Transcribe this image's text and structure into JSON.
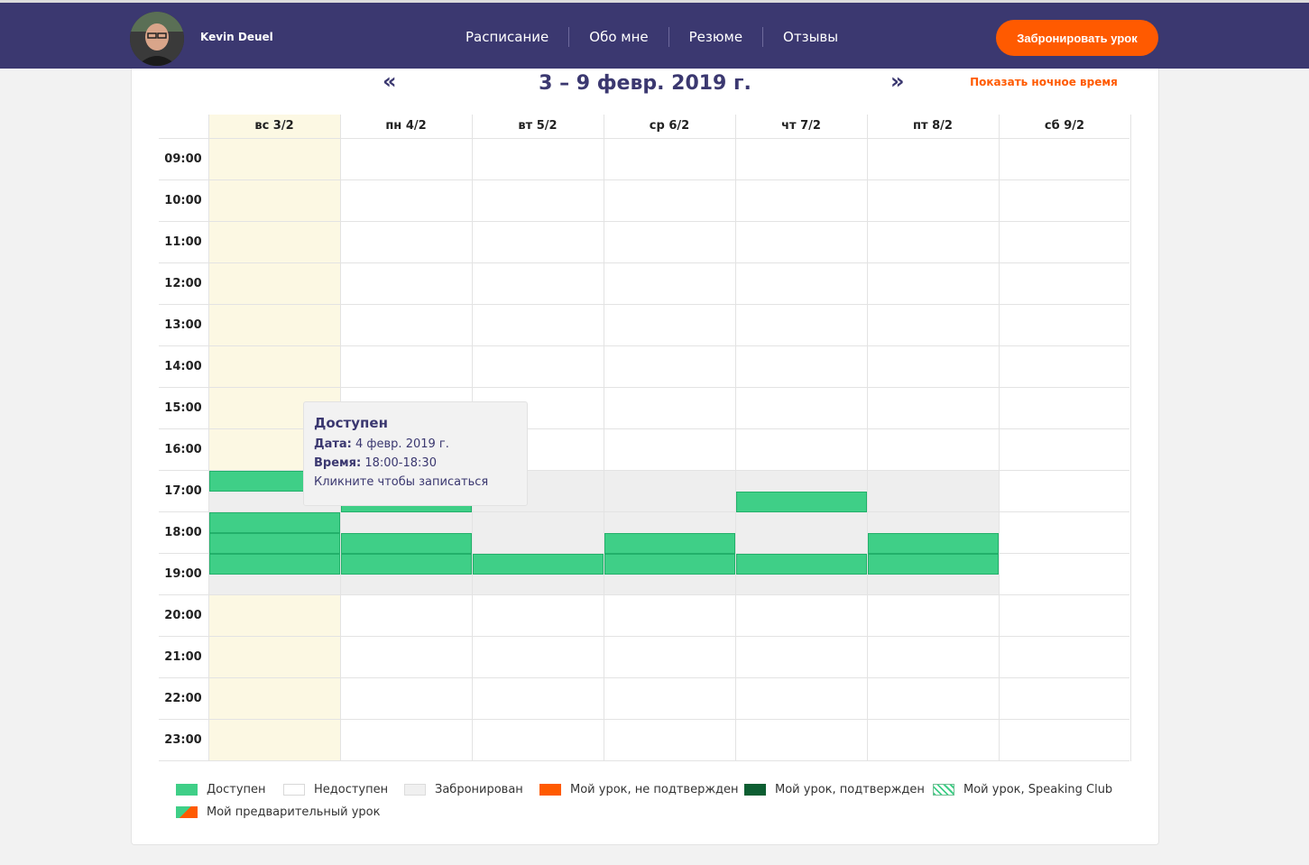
{
  "header": {
    "username": "Kevin Deuel",
    "nav": [
      "Расписание",
      "Обо мне",
      "Резюме",
      "Отзывы"
    ],
    "book_label": "Забронировать урок"
  },
  "calendar": {
    "prev": "«",
    "next": "»",
    "week_title": "3 – 9 февр. 2019 г.",
    "night_link": "Показать ночное время",
    "days": [
      "вс 3/2",
      "пн 4/2",
      "вт 5/2",
      "ср 6/2",
      "чт 7/2",
      "пт 8/2",
      "сб 9/2"
    ],
    "hours": [
      "09:00",
      "10:00",
      "11:00",
      "12:00",
      "13:00",
      "14:00",
      "15:00",
      "16:00",
      "17:00",
      "18:00",
      "19:00",
      "20:00",
      "21:00",
      "22:00",
      "23:00"
    ],
    "today_index": 0,
    "booked": [
      {
        "day": 0,
        "start": "17:00",
        "end": "20:00"
      },
      {
        "day": 1,
        "start": "17:00",
        "end": "20:00"
      },
      {
        "day": 2,
        "start": "17:00",
        "end": "20:00"
      },
      {
        "day": 3,
        "start": "17:00",
        "end": "20:00"
      },
      {
        "day": 4,
        "start": "17:00",
        "end": "20:00"
      },
      {
        "day": 5,
        "start": "17:00",
        "end": "20:00"
      }
    ],
    "available": [
      {
        "day": 0,
        "start": "17:00",
        "end": "17:30"
      },
      {
        "day": 0,
        "start": "18:00",
        "end": "18:30"
      },
      {
        "day": 0,
        "start": "18:30",
        "end": "19:00"
      },
      {
        "day": 0,
        "start": "19:00",
        "end": "19:30"
      },
      {
        "day": 1,
        "start": "17:30",
        "end": "18:00"
      },
      {
        "day": 1,
        "start": "18:30",
        "end": "19:00"
      },
      {
        "day": 1,
        "start": "19:00",
        "end": "19:30"
      },
      {
        "day": 2,
        "start": "19:00",
        "end": "19:30"
      },
      {
        "day": 3,
        "start": "18:30",
        "end": "19:00"
      },
      {
        "day": 3,
        "start": "19:00",
        "end": "19:30"
      },
      {
        "day": 4,
        "start": "17:30",
        "end": "18:00"
      },
      {
        "day": 4,
        "start": "19:00",
        "end": "19:30"
      },
      {
        "day": 5,
        "start": "18:30",
        "end": "19:00"
      },
      {
        "day": 5,
        "start": "19:00",
        "end": "19:30"
      }
    ]
  },
  "tooltip": {
    "title": "Доступен",
    "date_label": "Дата:",
    "date_value": "4 февр. 2019 г.",
    "time_label": "Время:",
    "time_value": "18:00-18:30",
    "hint": "Кликните чтобы записаться"
  },
  "legend": [
    {
      "label": "Доступен",
      "type": "available"
    },
    {
      "label": "Недоступен",
      "type": "unavailable"
    },
    {
      "label": "Забронирован",
      "type": "booked"
    },
    {
      "label": "Мой урок, не подтвержден",
      "type": "pending"
    },
    {
      "label": "Мой урок, подтвержден",
      "type": "confirmed"
    },
    {
      "label": "Мой урок, Speaking Club",
      "type": "speaking"
    },
    {
      "label": "Мой предварительный урок",
      "type": "trial"
    }
  ],
  "colors": {
    "header_bg": "#3b3870",
    "accent": "#ff5a00",
    "available": "#3fcf87",
    "available_border": "#22b06a",
    "booked": "#eeeeee",
    "today": "#fcf8e3",
    "confirmed": "#0d5e32"
  }
}
